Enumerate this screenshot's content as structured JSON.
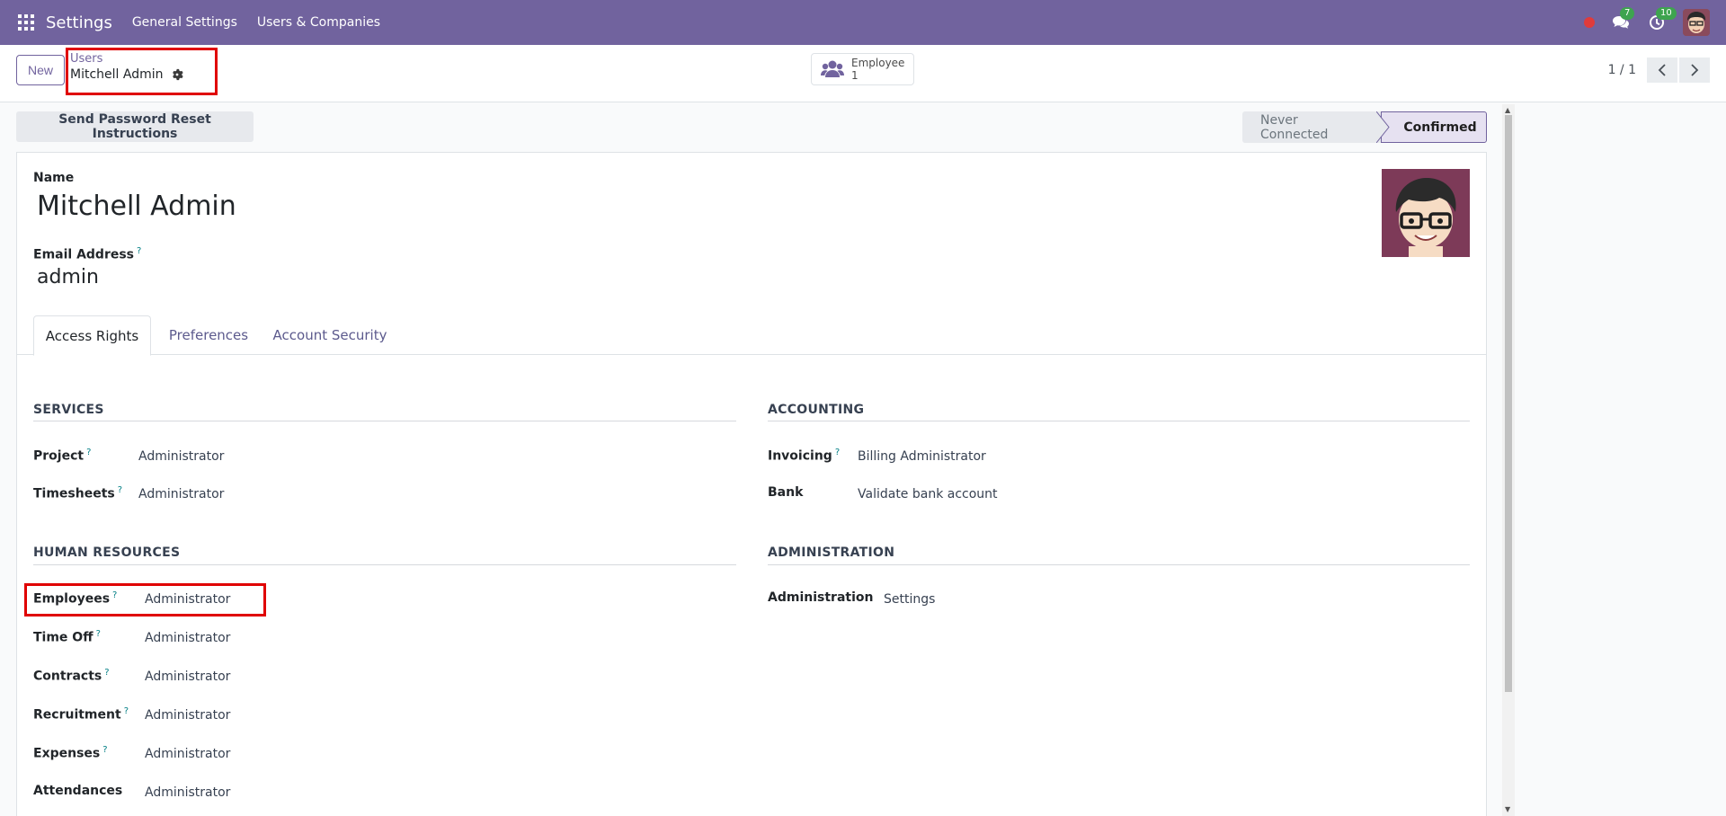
{
  "topnav": {
    "app_name": "Settings",
    "links": [
      "General Settings",
      "Users & Companies"
    ],
    "messages_count": "7",
    "activities_count": "10"
  },
  "control_panel": {
    "new_label": "New",
    "breadcrumb_parent": "Users",
    "breadcrumb_current": "Mitchell Admin",
    "smart_button": {
      "label": "Employee",
      "count": "1"
    },
    "pager": "1 / 1"
  },
  "header": {
    "reset_button": "Send Password Reset Instructions",
    "statuses": [
      "Never Connected",
      "Confirmed"
    ],
    "active_status": "Confirmed"
  },
  "form": {
    "name_label": "Name",
    "name_value": "Mitchell Admin",
    "email_label": "Email Address",
    "email_value": "admin",
    "help_mark": "?",
    "tabs": [
      "Access Rights",
      "Preferences",
      "Account Security"
    ],
    "sections": {
      "services": {
        "title": "SERVICES",
        "fields": [
          {
            "label": "Project",
            "value": "Administrator",
            "help": true
          },
          {
            "label": "Timesheets",
            "value": "Administrator",
            "help": true
          }
        ]
      },
      "accounting": {
        "title": "ACCOUNTING",
        "fields": [
          {
            "label": "Invoicing",
            "value": "Billing Administrator",
            "help": true
          },
          {
            "label": "Bank",
            "value": "Validate bank account",
            "help": false
          }
        ]
      },
      "human_resources": {
        "title": "HUMAN RESOURCES",
        "fields": [
          {
            "label": "Employees",
            "value": "Administrator",
            "help": true
          },
          {
            "label": "Time Off",
            "value": "Administrator",
            "help": true
          },
          {
            "label": "Contracts",
            "value": "Administrator",
            "help": true
          },
          {
            "label": "Recruitment",
            "value": "Administrator",
            "help": true
          },
          {
            "label": "Expenses",
            "value": "Administrator",
            "help": true
          },
          {
            "label": "Attendances",
            "value": "Administrator",
            "help": false
          }
        ]
      },
      "administration": {
        "title": "ADMINISTRATION",
        "fields": [
          {
            "label": "Administration",
            "value": "Settings",
            "help": false
          }
        ]
      }
    }
  },
  "colors": {
    "brand": "#71639e",
    "highlight": "#e00000",
    "badge": "#3ea44f",
    "help": "#017e84"
  }
}
